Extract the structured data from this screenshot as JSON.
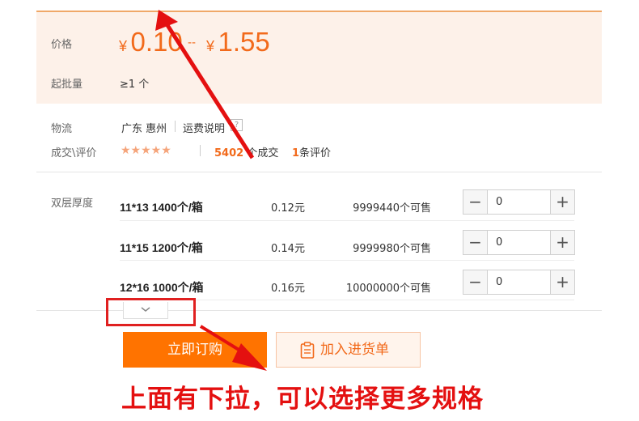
{
  "price": {
    "label": "价格",
    "currency": "¥",
    "low": "0.10",
    "separator": "--",
    "high": "1.55",
    "min_order_label": "起批量",
    "min_order_value": "≥1 个"
  },
  "logistics": {
    "label": "物流",
    "origin": "广东 惠州",
    "freight_link": "运费说明",
    "help_icon": "question-icon"
  },
  "deals": {
    "label": "成交\\评价",
    "rating_stars": 5,
    "stars_text": "★★★★★",
    "deal_count": "5402",
    "deal_suffix": "个成交",
    "review_count": "1",
    "review_suffix": "条评价"
  },
  "variants": {
    "label": "双层厚度",
    "rows": [
      {
        "spec": "11*13 1400个/箱",
        "price": "0.12元",
        "stock": "9999440个可售",
        "qty": "0"
      },
      {
        "spec": "11*15 1200个/箱",
        "price": "0.14元",
        "stock": "9999980个可售",
        "qty": "0"
      },
      {
        "spec": "12*16 1000个/箱",
        "price": "0.16元",
        "stock": "10000000个可售",
        "qty": "0"
      }
    ],
    "minus": "−",
    "plus": "+",
    "expand_icon": "chevron-down-icon"
  },
  "actions": {
    "buy_now": "立即订购",
    "add_to_list": "加入进货单",
    "add_icon": "clipboard-icon"
  },
  "annotation": {
    "caption": "上面有下拉，可以选择更多规格",
    "color": "#e41010"
  },
  "colors": {
    "accent": "#ff7300",
    "price": "#f26a1b",
    "panel_bg": "#fdf1e9"
  }
}
